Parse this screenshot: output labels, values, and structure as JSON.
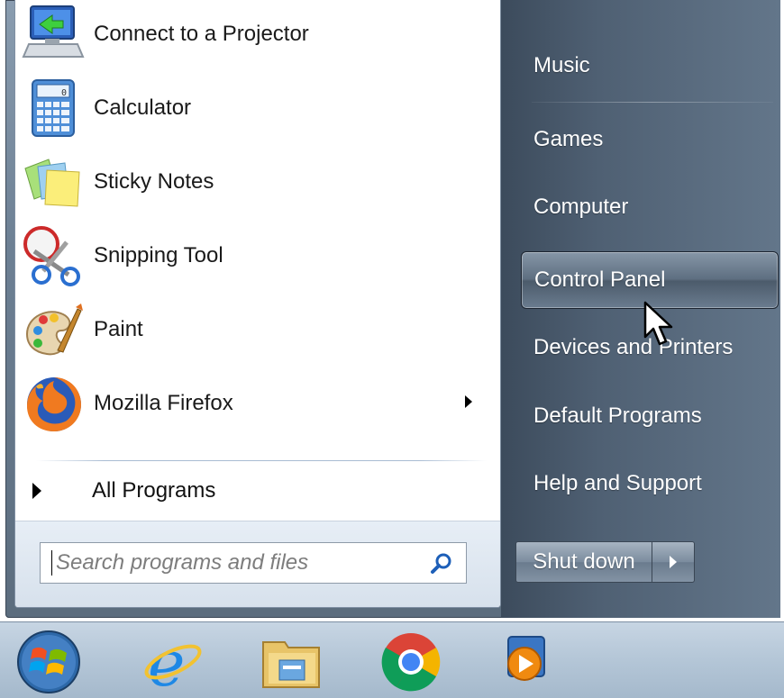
{
  "start_menu": {
    "programs": [
      {
        "label": "Connect to a Projector",
        "icon": "projector-icon"
      },
      {
        "label": "Calculator",
        "icon": "calculator-icon"
      },
      {
        "label": "Sticky Notes",
        "icon": "sticky-notes-icon"
      },
      {
        "label": "Snipping Tool",
        "icon": "snipping-tool-icon"
      },
      {
        "label": "Paint",
        "icon": "paint-icon"
      },
      {
        "label": "Mozilla Firefox",
        "icon": "firefox-icon",
        "has_submenu": true
      }
    ],
    "all_programs_label": "All Programs",
    "search": {
      "placeholder": "Search programs and files",
      "value": ""
    },
    "right_items": [
      {
        "label": "Music"
      },
      {
        "label": "Games"
      },
      {
        "label": "Computer"
      },
      {
        "label": "Control Panel",
        "highlighted": true
      },
      {
        "label": "Devices and Printers"
      },
      {
        "label": "Default Programs"
      },
      {
        "label": "Help and Support"
      }
    ],
    "shutdown_label": "Shut down"
  },
  "taskbar": {
    "items": [
      "start-orb-icon",
      "internet-explorer-icon",
      "file-explorer-icon",
      "chrome-icon",
      "media-player-icon"
    ]
  },
  "colors": {
    "right_pane": "#4f6073",
    "taskbar": "#b4c6d7",
    "accent_blue": "#2a7ad8"
  }
}
